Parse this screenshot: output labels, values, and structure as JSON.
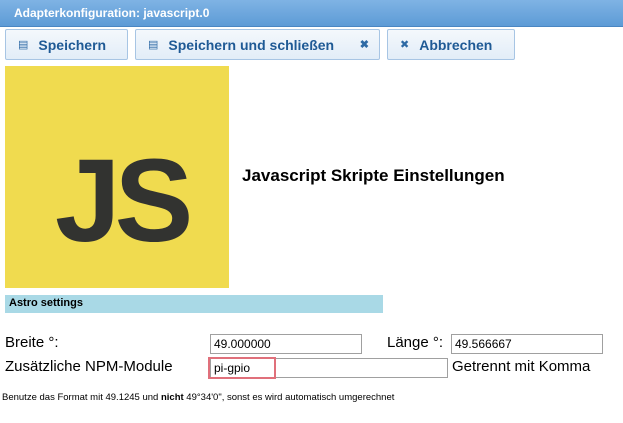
{
  "window": {
    "title": "Adapterkonfiguration: javascript.0"
  },
  "toolbar": {
    "save_label": "Speichern",
    "save_close_label": "Speichern und schließen",
    "cancel_label": "Abbrechen"
  },
  "logo": {
    "text": "JS",
    "bg_color": "#f0db4f",
    "fg_color": "#323330"
  },
  "heading": "Javascript Skripte Einstellungen",
  "section": {
    "title": "Astro settings"
  },
  "form": {
    "latitude": {
      "label": "Breite °:",
      "value": "49.000000"
    },
    "longitude": {
      "label": "Länge °:",
      "value": "49.566667"
    },
    "npm": {
      "label": "Zusätzliche NPM-Module",
      "value": "pi-gpio",
      "suffix": "Getrennt mit Komma"
    }
  },
  "hint": {
    "part1": "Benutze das Format mit 49.1245 und ",
    "bold": "nicht",
    "part2": " 49°34'0\", sonst es wird automatisch umgerechnet"
  }
}
